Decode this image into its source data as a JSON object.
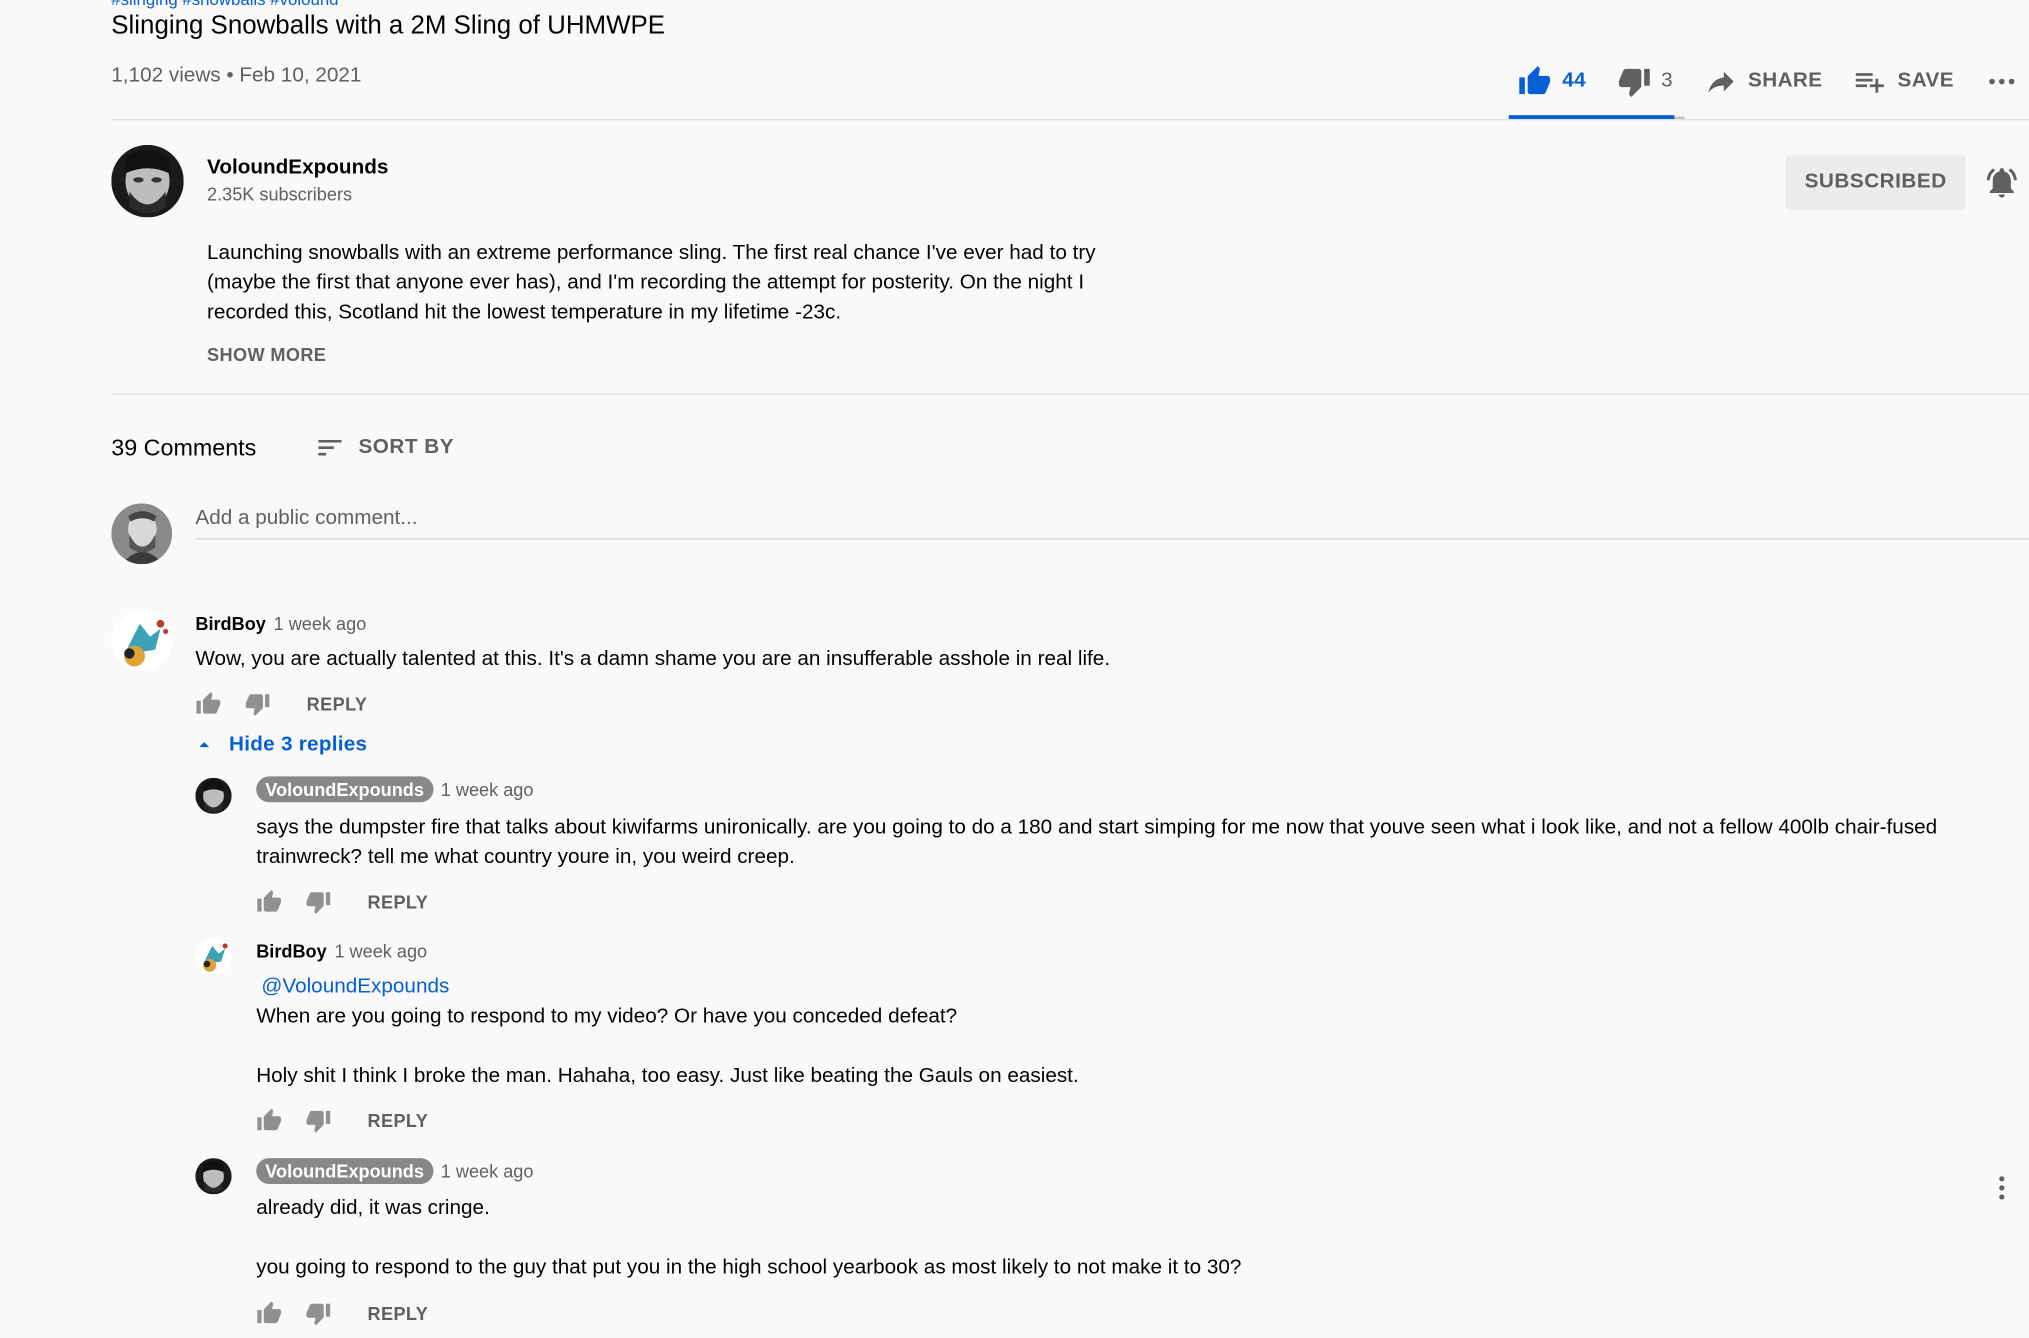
{
  "video": {
    "hashtags": "#slinging #snowballs #volound",
    "title": "Slinging Snowballs with a 2M Sling of UHMWPE",
    "meta": "1,102 views • Feb 10, 2021",
    "likes": "44",
    "dislikes": "3",
    "like_fraction": 0.94,
    "share_label": "SHARE",
    "save_label": "SAVE"
  },
  "channel": {
    "name": "VoloundExpounds",
    "subscribers": "2.35K subscribers",
    "subscribe_label": "SUBSCRIBED"
  },
  "description": {
    "text": "Launching snowballs with an extreme performance sling. The first real chance I've ever had to try (maybe the first that anyone ever has), and I'm recording the attempt for posterity. On the night I recorded this, Scotland hit the lowest temperature in my lifetime -23c.",
    "show_more": "SHOW MORE"
  },
  "comments": {
    "count_label": "39 Comments",
    "sort_label": "SORT BY",
    "add_placeholder": "Add a public comment...",
    "reply_label": "REPLY",
    "hide_replies_label": "Hide 3 replies",
    "top": {
      "author": "BirdBoy",
      "time": "1 week ago",
      "text": "Wow, you are actually talented at this. It's a damn shame you are an insufferable asshole in real life."
    },
    "replies": [
      {
        "author": "VoloundExpounds",
        "time": "1 week ago",
        "text": "says the dumpster fire that talks about kiwifarms unironically. are you going to do a 180 and start simping for me now that youve seen what i look like, and not a fellow 400lb chair-fused trainwreck? tell me what country youre in, you weird creep."
      },
      {
        "author": "BirdBoy",
        "time": "1 week ago",
        "mention": "@VoloundExpounds",
        "line1": "When are you going to respond to my video? Or have you conceded defeat?",
        "line2": "Holy shit I think I broke the man. Hahaha, too easy. Just like beating the Gauls on easiest."
      },
      {
        "author": "VoloundExpounds",
        "time": "1 week ago",
        "line1": "already did, it was cringe.",
        "line2": "you going to respond to the guy that put you in the high school yearbook as most likely to not make it to 30?"
      }
    ]
  },
  "colors": {
    "accent": "#065fd4",
    "text": "#030303",
    "secondary": "#606060",
    "background": "#f9f9f9"
  },
  "icons": [
    "thumb-up-icon",
    "thumb-down-icon",
    "share-arrow-icon",
    "playlist-add-icon",
    "more-horiz-icon",
    "bell-icon",
    "sort-icon",
    "chevron-up-icon",
    "more-vert-icon"
  ]
}
